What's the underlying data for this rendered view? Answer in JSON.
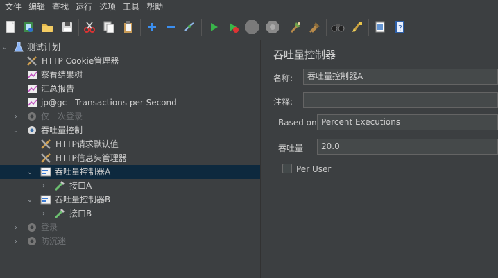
{
  "menubar": {
    "items": [
      "文件",
      "编辑",
      "查找",
      "运行",
      "选项",
      "工具",
      "帮助"
    ]
  },
  "toolbar": {
    "icons": [
      "new-icon",
      "templates-icon",
      "open-icon",
      "save-icon",
      "cut-icon",
      "copy-icon",
      "paste-icon",
      "expand-icon",
      "collapse-icon",
      "toggle-icon",
      "start-icon",
      "start-no-timers-icon",
      "stop-icon",
      "shutdown-icon",
      "clear-icon",
      "clear-all-icon",
      "search-icon",
      "reset-search-icon",
      "function-helper-icon",
      "help-icon"
    ]
  },
  "tree": {
    "items": [
      {
        "label": "测试计划",
        "icon": "flask-icon",
        "expanded": true,
        "disabled": false,
        "selected": false
      },
      {
        "label": "HTTP Cookie管理器",
        "icon": "config-icon",
        "disabled": false,
        "selected": false
      },
      {
        "label": "察看结果树",
        "icon": "listener-icon",
        "disabled": false,
        "selected": false
      },
      {
        "label": "汇总报告",
        "icon": "listener-icon",
        "disabled": false,
        "selected": false
      },
      {
        "label": "jp@gc - Transactions per Second",
        "icon": "listener-icon",
        "disabled": false,
        "selected": false
      },
      {
        "label": "仅一次登录",
        "icon": "gear-icon",
        "expanded": false,
        "disabled": true,
        "selected": false
      },
      {
        "label": "吞吐量控制",
        "icon": "gear-icon",
        "expanded": true,
        "disabled": false,
        "selected": false
      },
      {
        "label": "HTTP请求默认值",
        "icon": "config-icon",
        "disabled": false,
        "selected": false
      },
      {
        "label": "HTTP信息头管理器",
        "icon": "config-icon",
        "disabled": false,
        "selected": false
      },
      {
        "label": "吞吐量控制器A",
        "icon": "controller-icon",
        "expanded": true,
        "disabled": false,
        "selected": true
      },
      {
        "label": "接口A",
        "icon": "sampler-icon",
        "expanded": false,
        "disabled": false,
        "selected": false
      },
      {
        "label": "吞吐量控制器B",
        "icon": "controller-icon",
        "expanded": true,
        "disabled": false,
        "selected": false
      },
      {
        "label": "接口B",
        "icon": "sampler-icon",
        "expanded": false,
        "disabled": false,
        "selected": false
      },
      {
        "label": "登录",
        "icon": "gear-icon",
        "expanded": false,
        "disabled": true,
        "selected": false
      },
      {
        "label": "防沉迷",
        "icon": "gear-icon",
        "expanded": false,
        "disabled": true,
        "selected": false
      }
    ]
  },
  "panel": {
    "title": "吞吐量控制器",
    "name_label": "名称:",
    "name_value": "吞吐量控制器A",
    "comment_label": "注释:",
    "comment_value": "",
    "based_on_label": "Based on",
    "based_on_value": "Percent Executions",
    "throughput_label": "吞吐量",
    "throughput_value": "20.0",
    "per_user_label": "Per User",
    "per_user_checked": false
  }
}
